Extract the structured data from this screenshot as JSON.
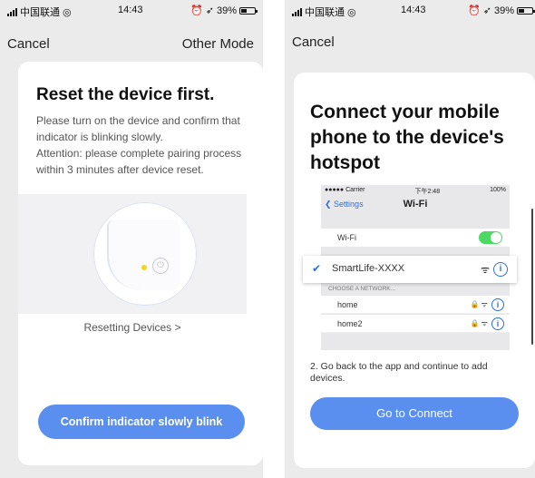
{
  "left": {
    "status": {
      "carrier": "中国联通",
      "time": "14:43",
      "battery": "39%",
      "battery_level": 0.39
    },
    "nav": {
      "cancel": "Cancel",
      "other_mode": "Other Mode"
    },
    "title": "Reset the device first.",
    "instructions": [
      "Please turn on the device and confirm that indicator is blinking slowly.",
      "Attention: please complete pairing process within 3 minutes after device reset."
    ],
    "resetting_link": "Resetting Devices >",
    "confirm_button": "Confirm indicator slowly blink",
    "colors": {
      "accent": "#5a8ff0",
      "indicator": "#f5d321"
    },
    "icons": {
      "power": "power-icon",
      "led": "indicator-led-icon"
    }
  },
  "right": {
    "status": {
      "carrier": "中国联通",
      "time": "14:43",
      "battery": "39%",
      "battery_level": 0.39
    },
    "nav": {
      "cancel": "Cancel"
    },
    "title": "Connect your mobile phone to the device's hotspot",
    "wifi_shot": {
      "status_left": "●●●●● Carrier",
      "status_time": "下午2:48",
      "status_right": "100%",
      "back": "Settings",
      "title": "Wi-Fi",
      "wifi_label": "Wi-Fi",
      "selected_network": "SmartLife-XXXX",
      "choose_header": "CHOOSE A NETWORK...",
      "networks": [
        "home",
        "home2"
      ]
    },
    "step_text": "2. Go back to the app and continue to add devices.",
    "connect_button": "Go to Connect",
    "colors": {
      "accent": "#5a8ff0",
      "ios_blue": "#2c6fe0",
      "toggle_on": "#4cd964"
    }
  }
}
